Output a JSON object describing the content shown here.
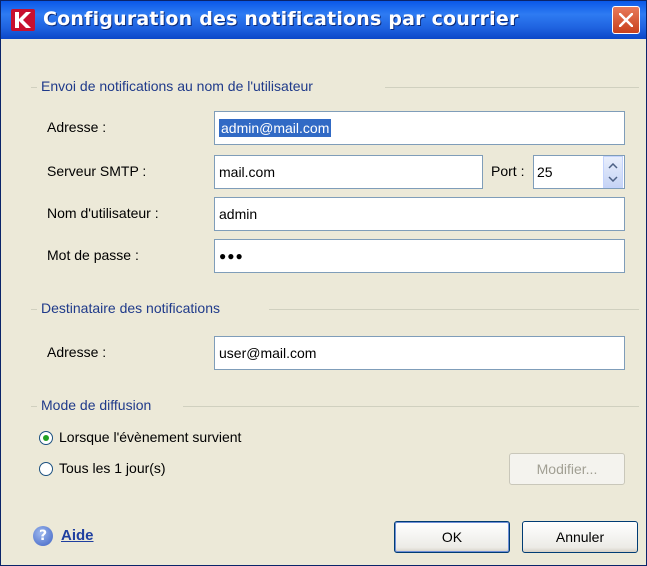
{
  "window": {
    "title": "Configuration des notifications par courrier"
  },
  "sender_group": {
    "legend": "Envoi de notifications au nom de l'utilisateur",
    "address_label": "Adresse :",
    "address_value": "admin@mail.com",
    "smtp_label": "Serveur  SMTP :",
    "smtp_value": "mail.com",
    "port_label": "Port :",
    "port_value": "25",
    "username_label": "Nom d'utilisateur :",
    "username_value": "admin",
    "password_label": "Mot de passe :",
    "password_value": "●●●"
  },
  "recipient_group": {
    "legend": "Destinataire des notifications",
    "address_label": "Adresse :",
    "address_value": "user@mail.com"
  },
  "mode_group": {
    "legend": "Mode de diffusion",
    "option_event": "Lorsque l'évènement survient",
    "option_daily": "Tous les 1 jour(s)",
    "modify_button": "Modifier...",
    "selected": "option_event"
  },
  "footer": {
    "help_link": "Aide",
    "ok_button": "OK",
    "cancel_button": "Annuler"
  },
  "colors": {
    "title_bar": "#0A58E8",
    "dialog_bg": "#ECE9D8",
    "selection": "#316AC5",
    "legend_text": "#1F3A8A"
  }
}
